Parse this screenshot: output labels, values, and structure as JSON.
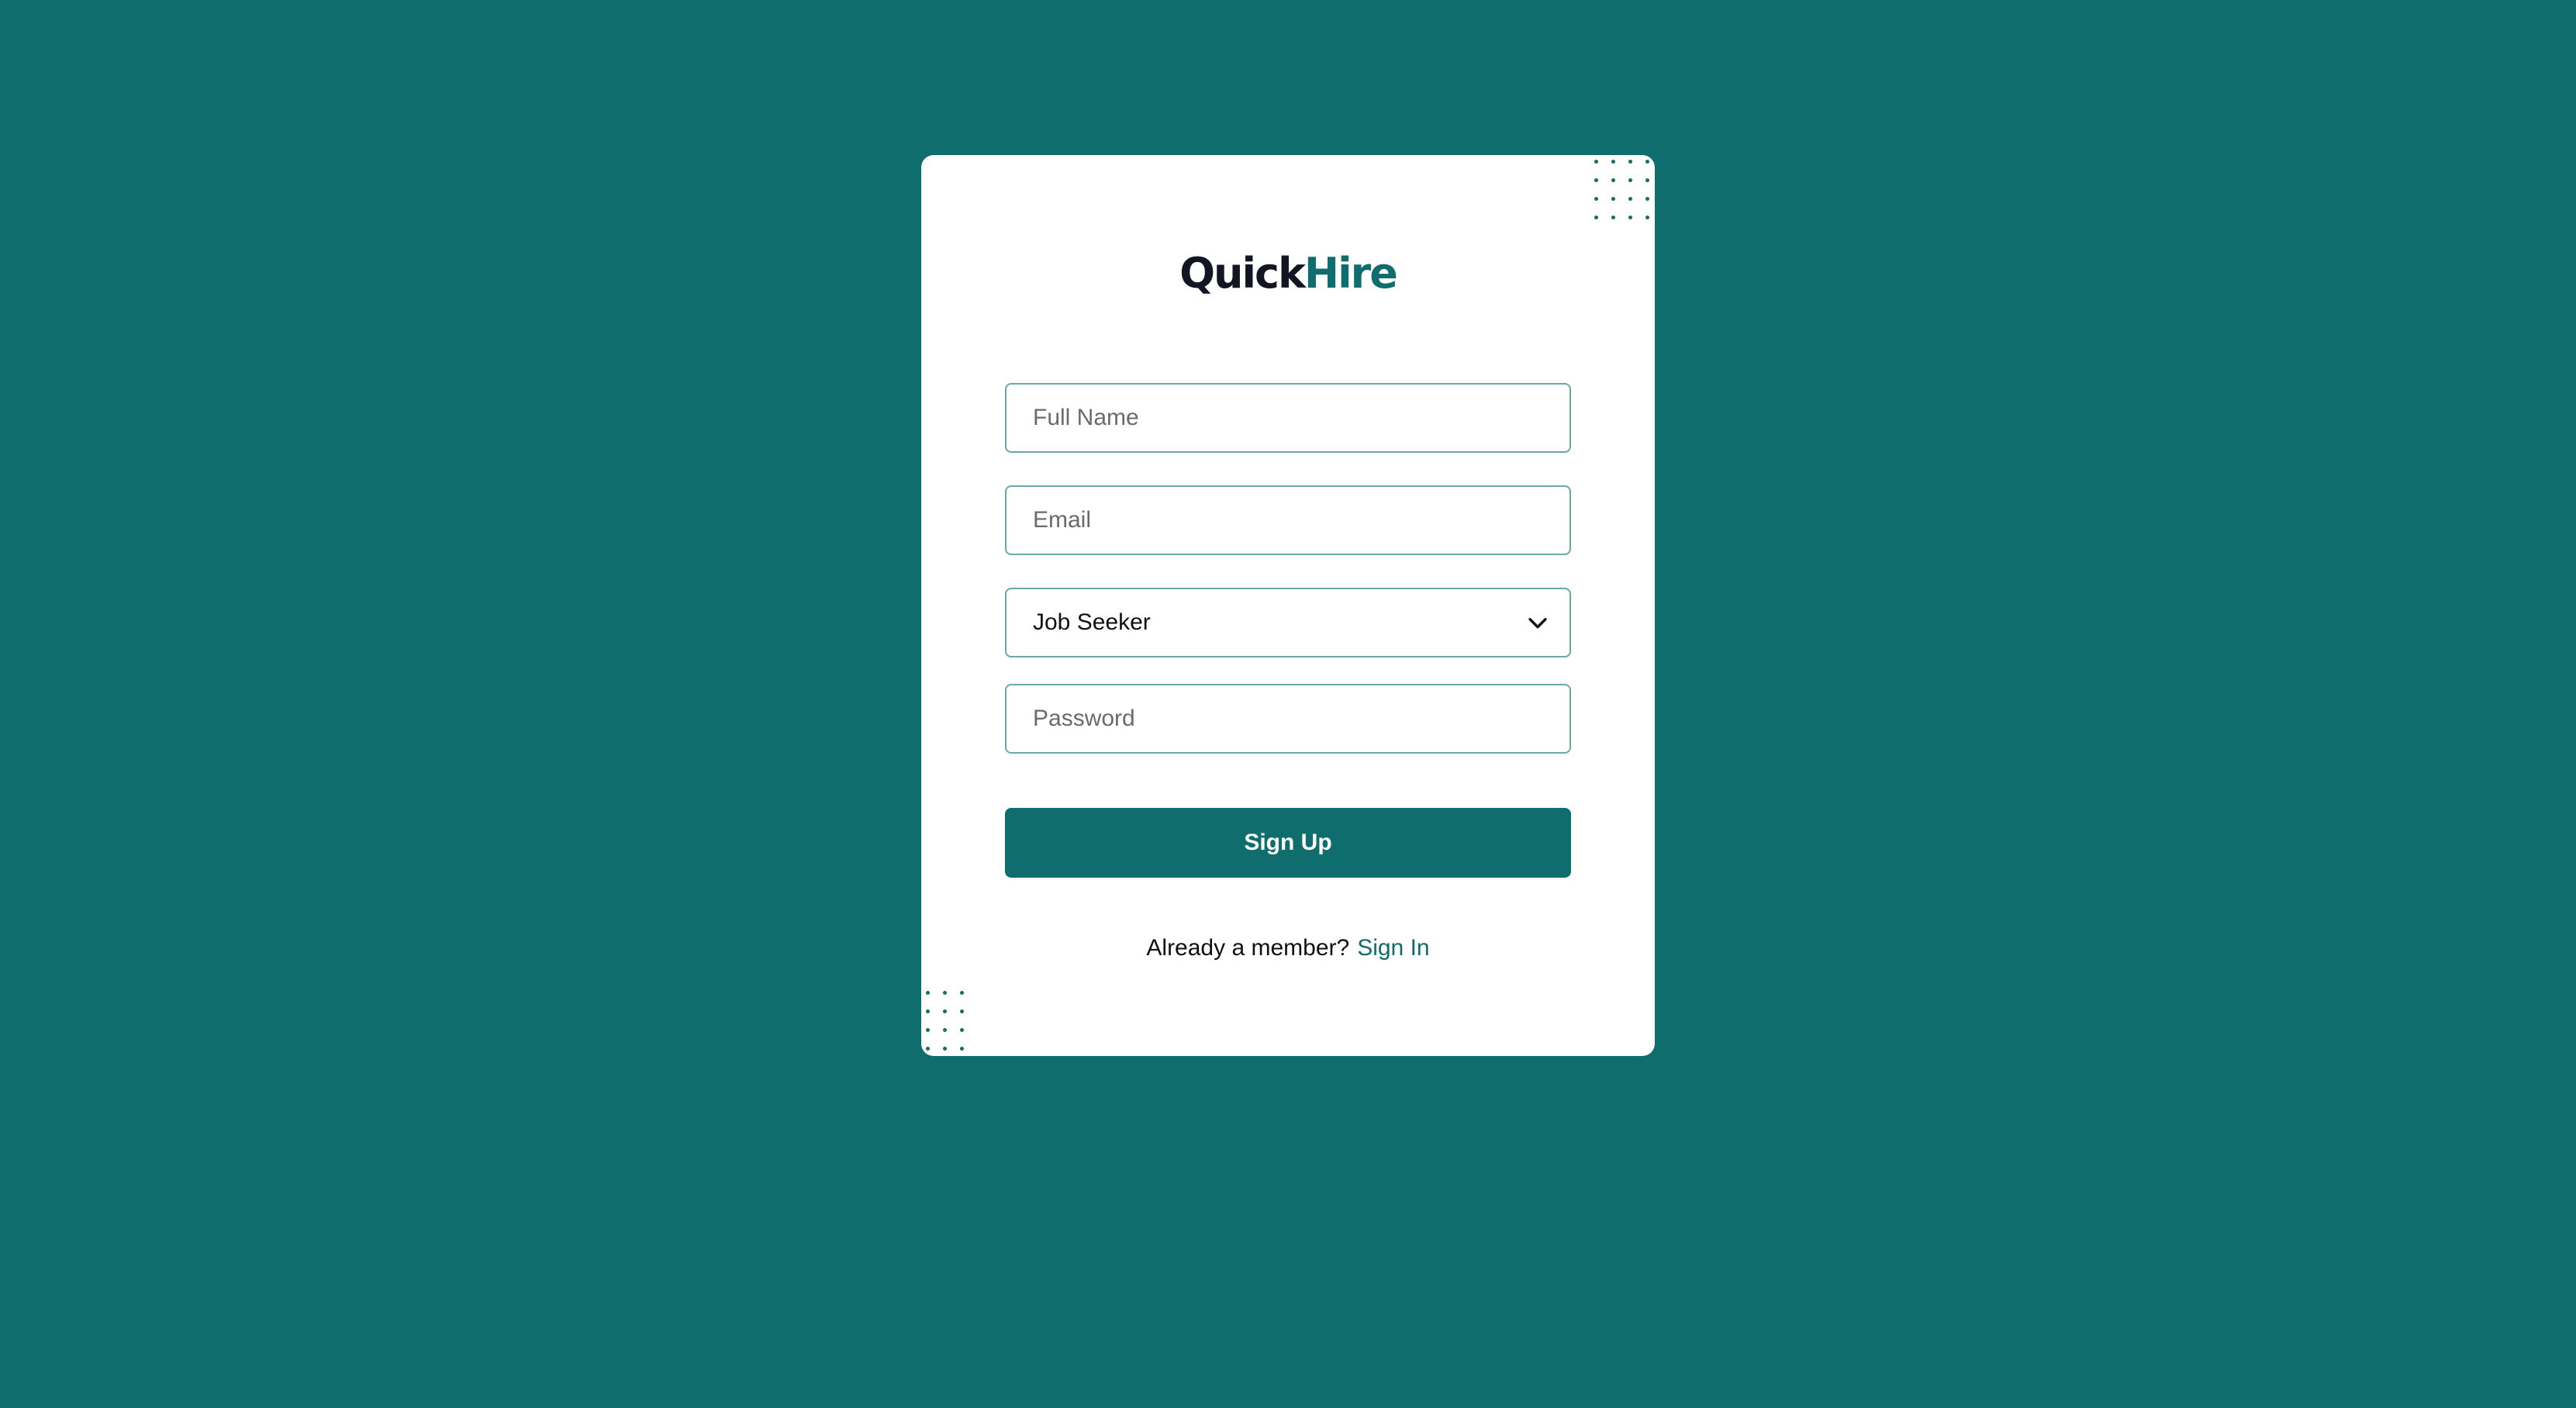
{
  "brand": {
    "part1": "Quick",
    "part2": "Hire"
  },
  "form": {
    "full_name_placeholder": "Full Name",
    "email_placeholder": "Email",
    "role_value": "Job Seeker",
    "password_placeholder": "Password",
    "submit_label": "Sign Up"
  },
  "footer": {
    "question": "Already a member?",
    "signin_label": "Sign In"
  },
  "colors": {
    "background": "#0f6e6d",
    "accent": "#0f6e6d",
    "logo_dark": "#111622",
    "card": "#ffffff"
  },
  "icons": {
    "select_arrow": "chevron-down-icon",
    "decoration": "dot-grid-decoration"
  }
}
